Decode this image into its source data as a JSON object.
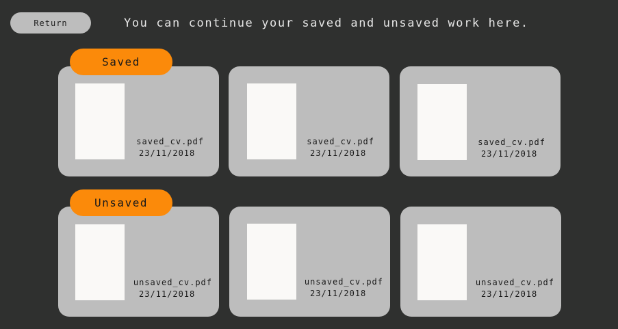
{
  "header": {
    "return_label": "Return",
    "message": "You can continue your saved and unsaved work here."
  },
  "sections": [
    {
      "label": "Saved",
      "files": [
        {
          "name": "saved_cv.pdf",
          "date": "23/11/2018"
        },
        {
          "name": "saved_cv.pdf",
          "date": "23/11/2018"
        },
        {
          "name": "saved_cv.pdf",
          "date": "23/11/2018"
        }
      ]
    },
    {
      "label": "Unsaved",
      "files": [
        {
          "name": "unsaved_cv.pdf",
          "date": "23/11/2018"
        },
        {
          "name": "unsaved_cv.pdf",
          "date": "23/11/2018"
        },
        {
          "name": "unsaved_cv.pdf",
          "date": "23/11/2018"
        }
      ]
    }
  ]
}
